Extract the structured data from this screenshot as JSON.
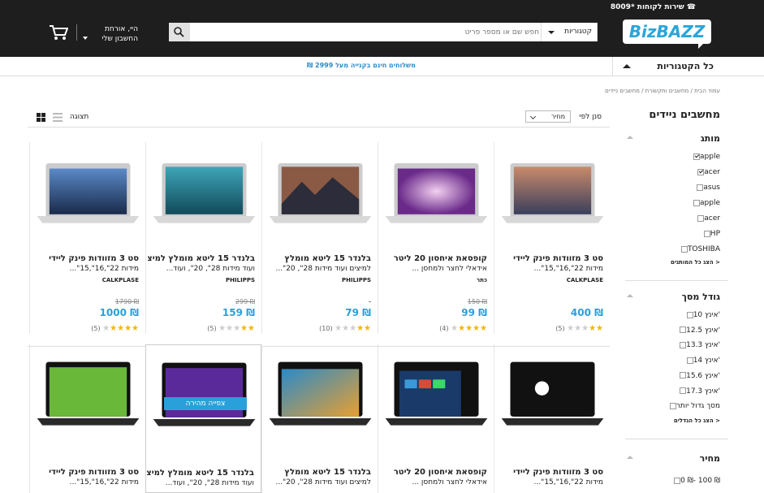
{
  "header": {
    "service_label": "שירות לקוחות *8009",
    "logo": "BizBAZZ",
    "categories_label": "קטגוריות",
    "search_placeholder": "חפש שם או מספר פריט",
    "account_line1": "היי, אורחת",
    "account_line2": "החשבון שלי"
  },
  "nav": {
    "all_categories": "כל הקטגוריות",
    "promo": "משלוחים חינם בקנייה מעל 2999 ₪"
  },
  "breadcrumb": "עמוד הבית / מחשבים ותקשורת / מחשבים ניידים",
  "sidebar": {
    "title": "מחשבים ניידים",
    "brand": {
      "title": "מותג",
      "items": [
        {
          "label": "apple",
          "checked": true
        },
        {
          "label": "acer",
          "checked": true
        },
        {
          "label": "asus",
          "checked": false
        },
        {
          "label": "apple",
          "checked": false
        },
        {
          "label": "acer",
          "checked": false
        },
        {
          "label": "HP",
          "checked": false
        },
        {
          "label": "TOSHIBA",
          "checked": false
        }
      ],
      "more": "הצג כל המותגים >"
    },
    "screen": {
      "title": "גודל מסך",
      "items": [
        {
          "label": "10 אינץ'"
        },
        {
          "label": "12.5 אינץ'"
        },
        {
          "label": "13.3 אינץ'"
        },
        {
          "label": "14 אינץ'"
        },
        {
          "label": "15.6 אינץ'"
        },
        {
          "label": "17.3 אינץ'"
        },
        {
          "label": "מסך גדול יותר"
        }
      ],
      "more": "הצג כל הגדלים >"
    },
    "price": {
      "title": "מחיר",
      "items": [
        {
          "label": "0 ₪- 100 ₪"
        }
      ]
    }
  },
  "toolbar": {
    "sort_label": "סנן לפי",
    "sort_value": "מחיר",
    "view_label": "תצוגה"
  },
  "products_row1": [
    {
      "title": "סט 3 מזוודות פינק ליידי",
      "sub": "מידות 22\",16\",15\"...",
      "brand": "CALKPLASE",
      "old": "",
      "price": "400 ₪",
      "stars": 2,
      "reviews": "(5)",
      "img": "mac-yosemite"
    },
    {
      "title": "קופסאת איחסון 20 ליטר",
      "sub": "אידאלי לחצר ולמחסן ...",
      "brand": "כתר",
      "old": "150 ₪",
      "price": "99 ₪",
      "stars": 4,
      "reviews": "(4)",
      "img": "mac-air-purple"
    },
    {
      "title": "בלנדר 15 ליטא מומלץ",
      "sub": "למיצים ועוד מידות 28\", 20\"...",
      "brand": "PHILIPPS",
      "old": "-",
      "price": "79 ₪",
      "stars": 2,
      "reviews": "(10)",
      "img": "mac-mountain"
    },
    {
      "title": "בלנדר 15 ליטא מומלץ למיצים",
      "sub": "ועוד מידות 28\", 20\", ועוד...",
      "brand": "PHILIPPS",
      "old": "299 ₪",
      "price": "159 ₪",
      "stars": 2,
      "reviews": "(5)",
      "img": "mac-mavericks"
    },
    {
      "title": "סט 3 מזוודות פינק ליידי",
      "sub": "מידות 22\",16\",15\"...",
      "brand": "CALKPLASE",
      "old": "1790 ₪",
      "price": "1000 ₪",
      "stars": 4,
      "reviews": "(5)",
      "img": "mac-air-blue"
    }
  ],
  "products_row2": [
    {
      "title": "סט 3 מזוודות פינק ליידי",
      "sub": "מידות 22\",16\",15\"...",
      "img": "hp250"
    },
    {
      "title": "קופסאת איחסון 20 ליטר",
      "sub": "אידאלי לחצר ולמחסן ...",
      "img": "acer-tablet"
    },
    {
      "title": "בלנדר 15 ליטא מומלץ",
      "sub": "למיצים ועוד מידות 28\", 20\"...",
      "img": "acer-aspire"
    },
    {
      "title": "בלנדר 15 ליטא מומלץ למיצים",
      "sub": "ועוד מידות 28\", 20\", ועוד...",
      "badge": "צפייה מהירה",
      "img": "acer-win8"
    },
    {
      "title": "סט 3 מזוודות פינק ליידי",
      "sub": "מידות 22\",16\",15\"...",
      "img": "acer-green"
    }
  ]
}
